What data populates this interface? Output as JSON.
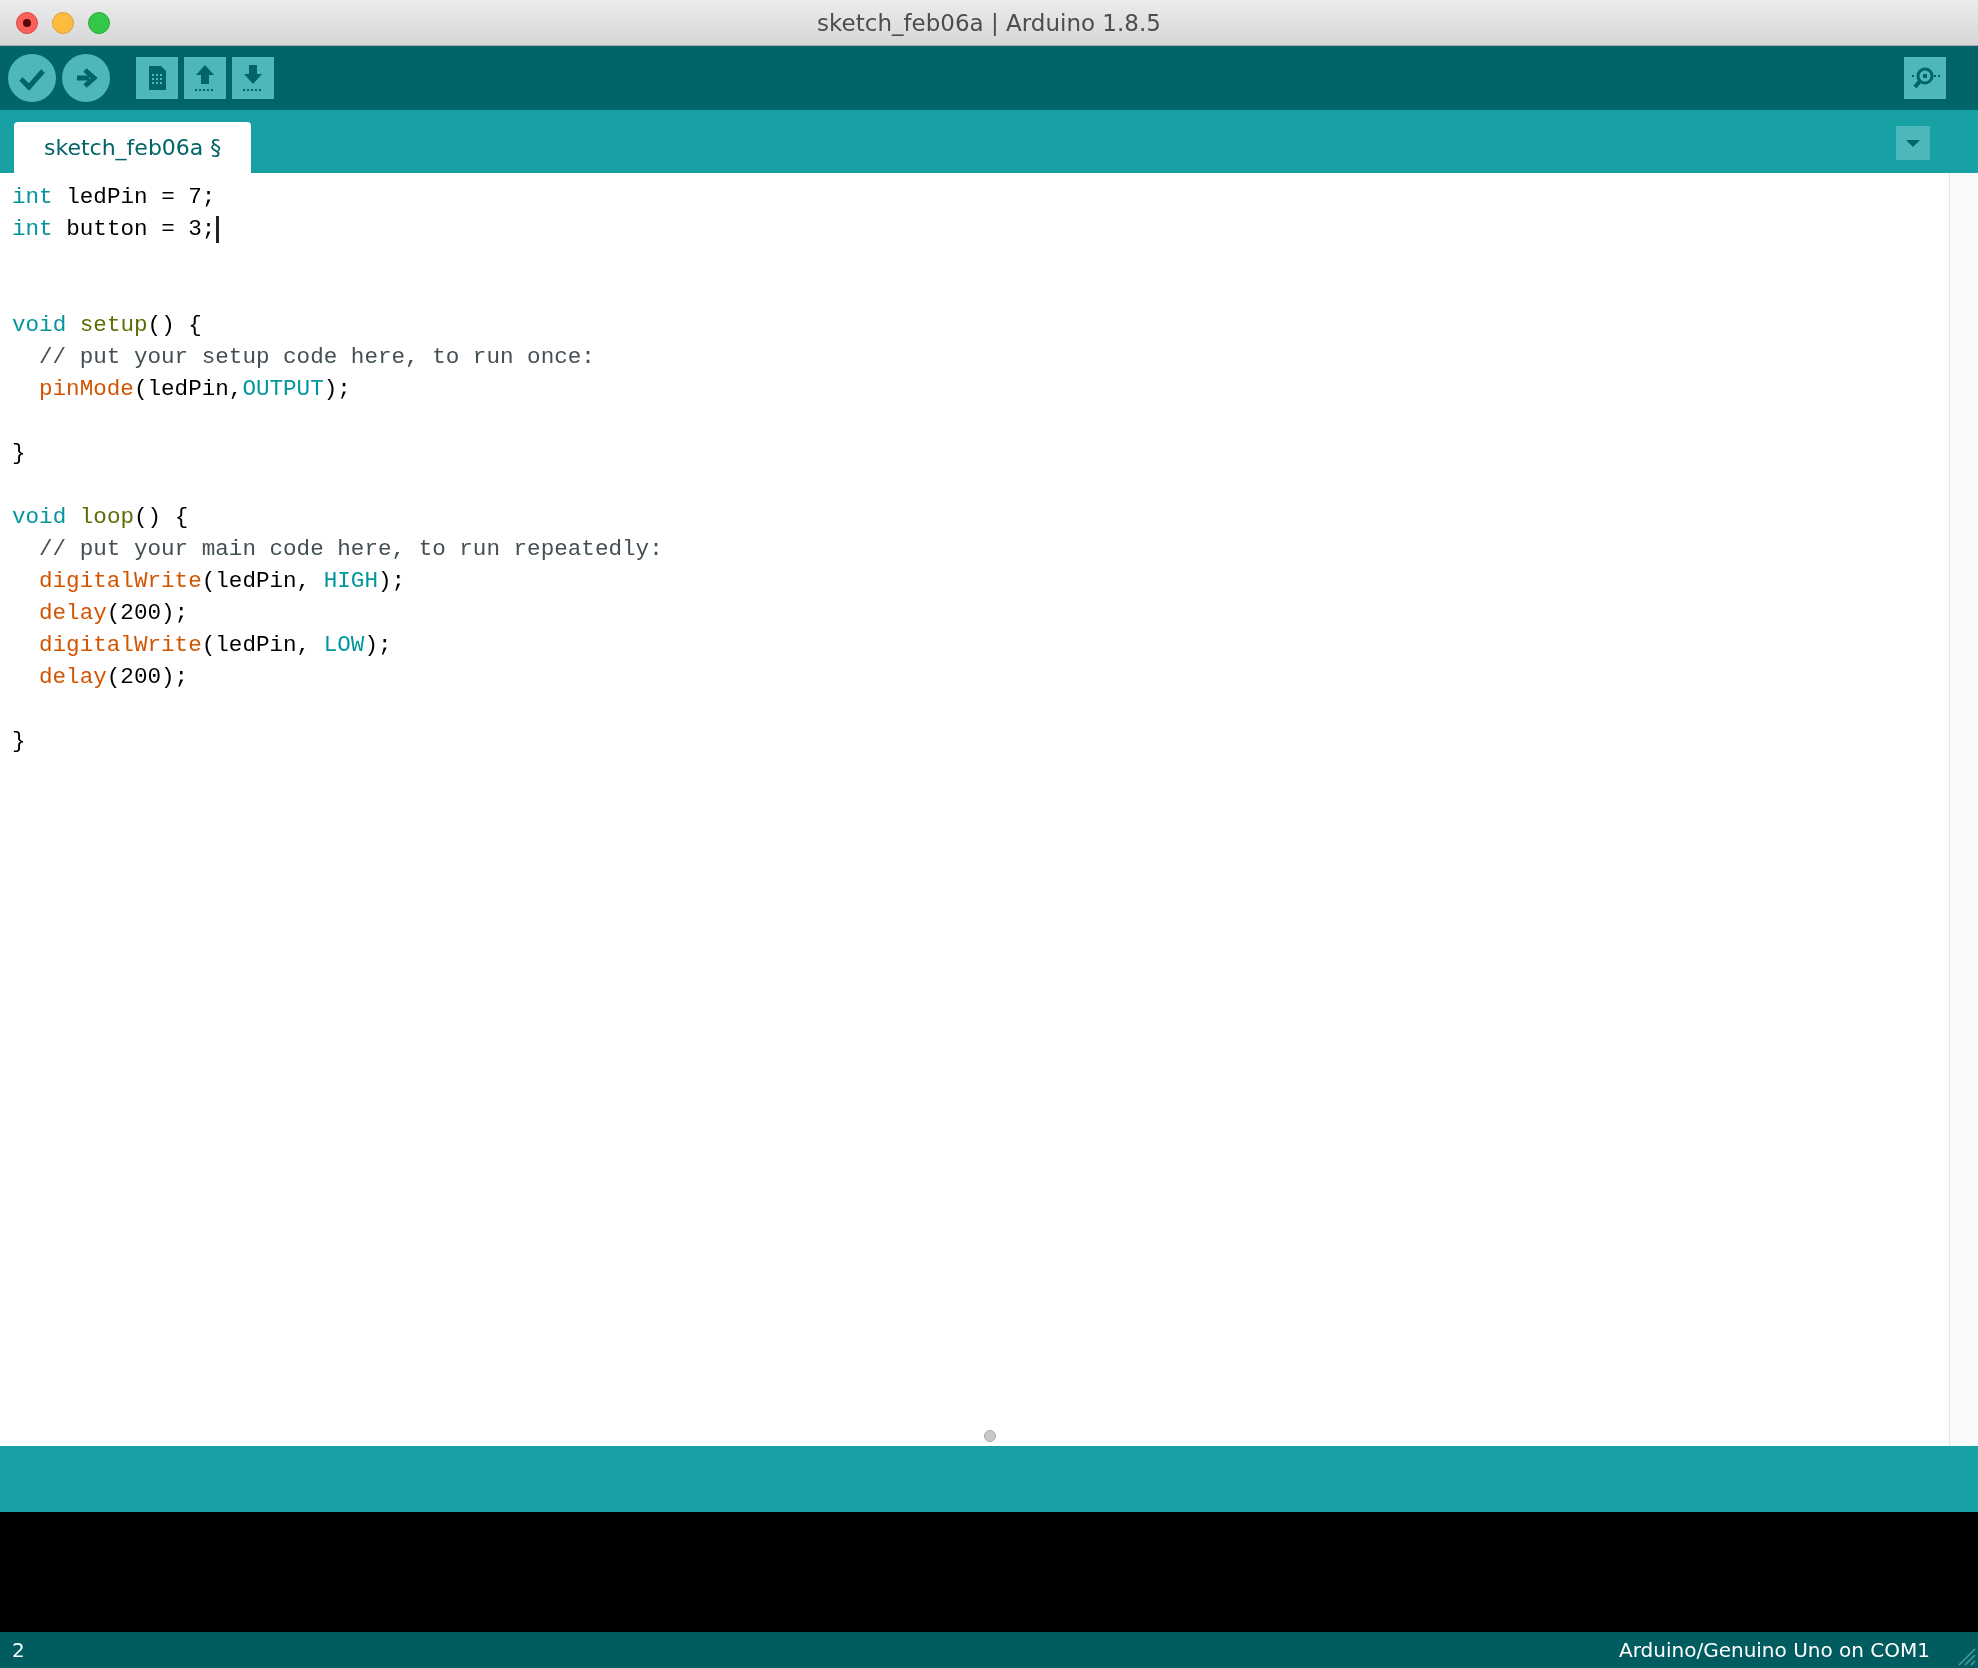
{
  "window": {
    "title": "sketch_feb06a | Arduino 1.8.5"
  },
  "toolbar": {
    "buttons": [
      {
        "kind": "verify"
      },
      {
        "kind": "upload"
      },
      {
        "kind": "new"
      },
      {
        "kind": "open"
      },
      {
        "kind": "save"
      }
    ],
    "right_buttons": [
      {
        "kind": "serial"
      }
    ]
  },
  "tabs": [
    {
      "label": "sketch_feb06a §",
      "selected": true
    }
  ],
  "editor": {
    "lines": [
      {
        "kind": "code",
        "indented": false,
        "cursor": false,
        "tokens": [
          {
            "text": "int",
            "kind": "type"
          },
          {
            "text": " ledPin = 7;",
            "kind": "plain"
          }
        ]
      },
      {
        "kind": "code",
        "indented": false,
        "cursor": true,
        "tokens": [
          {
            "text": "int",
            "kind": "type"
          },
          {
            "text": " button = 3;",
            "kind": "plain"
          }
        ]
      },
      {
        "kind": "blank"
      },
      {
        "kind": "blank"
      },
      {
        "kind": "code",
        "indented": false,
        "cursor": false,
        "tokens": [
          {
            "text": "void ",
            "kind": "type"
          },
          {
            "text": "setup",
            "kind": "function"
          },
          {
            "text": "() {",
            "kind": "plain"
          }
        ]
      },
      {
        "kind": "code",
        "indented": true,
        "cursor": false,
        "tokens": [
          {
            "text": "// put your setup code here, to run once:",
            "kind": "comment"
          }
        ]
      },
      {
        "kind": "code",
        "indented": true,
        "cursor": false,
        "tokens": [
          {
            "text": "pinMode",
            "kind": "builtin"
          },
          {
            "text": "(ledPin,",
            "kind": "plain"
          },
          {
            "text": "OUTPUT",
            "kind": "constant"
          },
          {
            "text": ");",
            "kind": "plain"
          }
        ]
      },
      {
        "kind": "blank"
      },
      {
        "kind": "code",
        "indented": false,
        "cursor": false,
        "tokens": [
          {
            "text": "}",
            "kind": "plain"
          }
        ]
      },
      {
        "kind": "blank"
      },
      {
        "kind": "code",
        "indented": false,
        "cursor": false,
        "tokens": [
          {
            "text": "void ",
            "kind": "type"
          },
          {
            "text": "loop",
            "kind": "function"
          },
          {
            "text": "() {",
            "kind": "plain"
          }
        ]
      },
      {
        "kind": "code",
        "indented": true,
        "cursor": false,
        "tokens": [
          {
            "text": "// put your main code here, to run repeatedly:",
            "kind": "comment"
          }
        ]
      },
      {
        "kind": "code",
        "indented": true,
        "cursor": false,
        "tokens": [
          {
            "text": "digitalWrite",
            "kind": "builtin"
          },
          {
            "text": "(ledPin, ",
            "kind": "plain"
          },
          {
            "text": "HIGH",
            "kind": "constant"
          },
          {
            "text": ");",
            "kind": "plain"
          }
        ]
      },
      {
        "kind": "code",
        "indented": true,
        "cursor": false,
        "tokens": [
          {
            "text": "delay",
            "kind": "builtin"
          },
          {
            "text": "(200);",
            "kind": "plain"
          }
        ]
      },
      {
        "kind": "code",
        "indented": true,
        "cursor": false,
        "tokens": [
          {
            "text": "digitalWrite",
            "kind": "builtin"
          },
          {
            "text": "(ledPin, ",
            "kind": "plain"
          },
          {
            "text": "LOW",
            "kind": "constant"
          },
          {
            "text": ");",
            "kind": "plain"
          }
        ]
      },
      {
        "kind": "code",
        "indented": true,
        "cursor": false,
        "tokens": [
          {
            "text": "delay",
            "kind": "builtin"
          },
          {
            "text": "(200);",
            "kind": "plain"
          }
        ]
      },
      {
        "kind": "blank"
      },
      {
        "kind": "code",
        "indented": false,
        "cursor": false,
        "tokens": [
          {
            "text": "}",
            "kind": "plain"
          }
        ]
      }
    ]
  },
  "status_bar": {
    "line_number": "2",
    "board": "Arduino/Genuino Uno on COM1"
  }
}
